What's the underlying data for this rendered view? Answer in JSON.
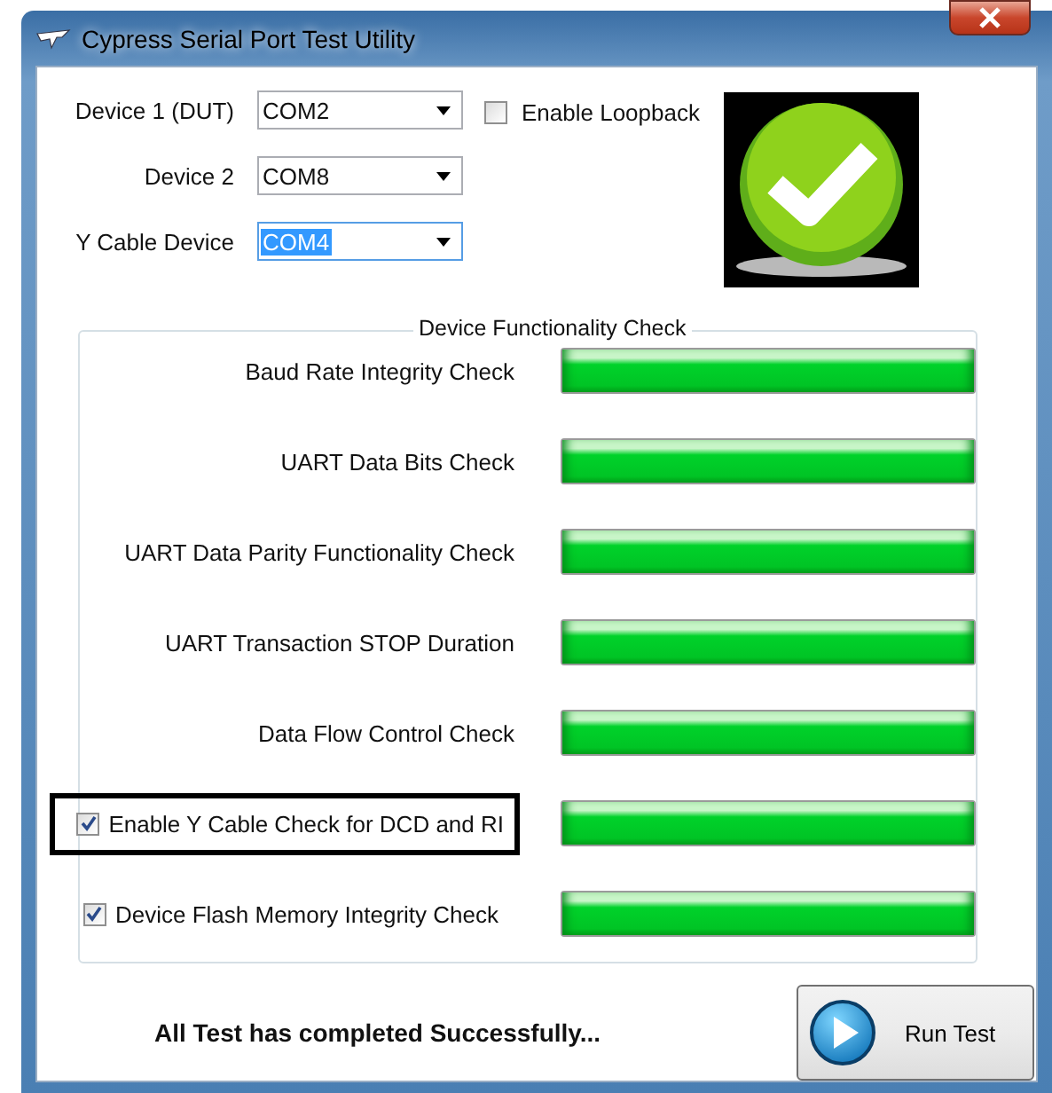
{
  "window": {
    "title": "Cypress Serial Port Test Utility"
  },
  "devices": [
    {
      "label": "Device 1 (DUT)",
      "value": "COM2",
      "selected": false
    },
    {
      "label": "Device 2",
      "value": "COM8",
      "selected": false
    },
    {
      "label": "Y Cable Device",
      "value": "COM4",
      "selected": true
    }
  ],
  "loopback": {
    "label": "Enable Loopback",
    "checked": false
  },
  "result_icon": {
    "kind": "success"
  },
  "group": {
    "title": "Device Functionality Check",
    "checks": [
      {
        "kind": "label",
        "label": "Baud Rate Integrity Check",
        "level": 1
      },
      {
        "kind": "label",
        "label": "UART Data Bits Check",
        "level": 1
      },
      {
        "kind": "label",
        "label": "UART Data Parity Functionality Check",
        "level": 1
      },
      {
        "kind": "label",
        "label": "UART Transaction STOP Duration",
        "level": 1
      },
      {
        "kind": "label",
        "label": "Data Flow Control Check",
        "level": 1
      },
      {
        "kind": "checkbox",
        "label": "Enable Y Cable Check for DCD and RI",
        "checked": true,
        "highlighted": true,
        "level": 1
      },
      {
        "kind": "checkbox",
        "label": "Device Flash Memory Integrity Check",
        "checked": true,
        "highlighted": false,
        "level": 1
      }
    ]
  },
  "status": "All Test has completed Successfully...",
  "run_button": {
    "label": "Run Test"
  }
}
